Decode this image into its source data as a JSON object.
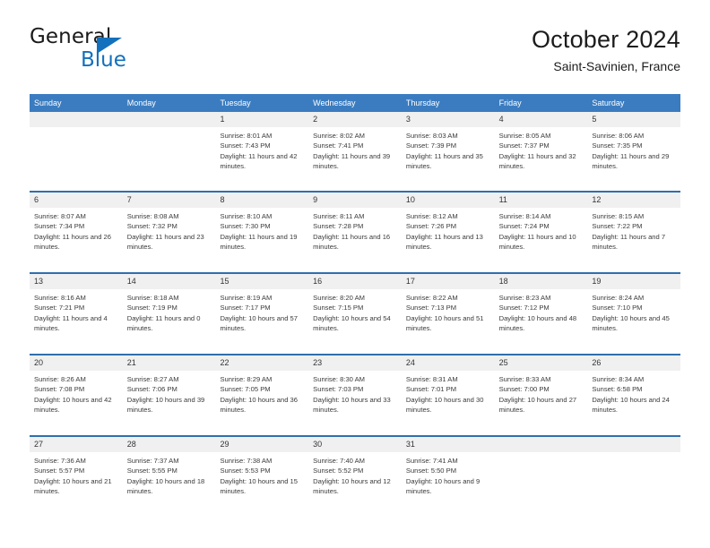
{
  "brand": {
    "name_top": "General",
    "name_bottom": "Blue",
    "accent_color": "#1270bd"
  },
  "header": {
    "title": "October 2024",
    "subtitle": "Saint-Savinien, France"
  },
  "theme": {
    "header_blue": "#3b7cc0",
    "row_rule_blue": "#2f6fad",
    "day_band_gray": "#f0f0f0"
  },
  "weekdays": [
    "Sunday",
    "Monday",
    "Tuesday",
    "Wednesday",
    "Thursday",
    "Friday",
    "Saturday"
  ],
  "labels": {
    "sunrise_prefix": "Sunrise:",
    "sunset_prefix": "Sunset:",
    "daylight_prefix": "Daylight:"
  },
  "weeks": [
    [
      {
        "day": "",
        "empty": true
      },
      {
        "day": "",
        "empty": true
      },
      {
        "day": "1",
        "sunrise": "Sunrise: 8:01 AM",
        "sunset": "Sunset: 7:43 PM",
        "daylight": "Daylight: 11 hours and 42 minutes."
      },
      {
        "day": "2",
        "sunrise": "Sunrise: 8:02 AM",
        "sunset": "Sunset: 7:41 PM",
        "daylight": "Daylight: 11 hours and 39 minutes."
      },
      {
        "day": "3",
        "sunrise": "Sunrise: 8:03 AM",
        "sunset": "Sunset: 7:39 PM",
        "daylight": "Daylight: 11 hours and 35 minutes."
      },
      {
        "day": "4",
        "sunrise": "Sunrise: 8:05 AM",
        "sunset": "Sunset: 7:37 PM",
        "daylight": "Daylight: 11 hours and 32 minutes."
      },
      {
        "day": "5",
        "sunrise": "Sunrise: 8:06 AM",
        "sunset": "Sunset: 7:35 PM",
        "daylight": "Daylight: 11 hours and 29 minutes."
      }
    ],
    [
      {
        "day": "6",
        "sunrise": "Sunrise: 8:07 AM",
        "sunset": "Sunset: 7:34 PM",
        "daylight": "Daylight: 11 hours and 26 minutes."
      },
      {
        "day": "7",
        "sunrise": "Sunrise: 8:08 AM",
        "sunset": "Sunset: 7:32 PM",
        "daylight": "Daylight: 11 hours and 23 minutes."
      },
      {
        "day": "8",
        "sunrise": "Sunrise: 8:10 AM",
        "sunset": "Sunset: 7:30 PM",
        "daylight": "Daylight: 11 hours and 19 minutes."
      },
      {
        "day": "9",
        "sunrise": "Sunrise: 8:11 AM",
        "sunset": "Sunset: 7:28 PM",
        "daylight": "Daylight: 11 hours and 16 minutes."
      },
      {
        "day": "10",
        "sunrise": "Sunrise: 8:12 AM",
        "sunset": "Sunset: 7:26 PM",
        "daylight": "Daylight: 11 hours and 13 minutes."
      },
      {
        "day": "11",
        "sunrise": "Sunrise: 8:14 AM",
        "sunset": "Sunset: 7:24 PM",
        "daylight": "Daylight: 11 hours and 10 minutes."
      },
      {
        "day": "12",
        "sunrise": "Sunrise: 8:15 AM",
        "sunset": "Sunset: 7:22 PM",
        "daylight": "Daylight: 11 hours and 7 minutes."
      }
    ],
    [
      {
        "day": "13",
        "sunrise": "Sunrise: 8:16 AM",
        "sunset": "Sunset: 7:21 PM",
        "daylight": "Daylight: 11 hours and 4 minutes."
      },
      {
        "day": "14",
        "sunrise": "Sunrise: 8:18 AM",
        "sunset": "Sunset: 7:19 PM",
        "daylight": "Daylight: 11 hours and 0 minutes."
      },
      {
        "day": "15",
        "sunrise": "Sunrise: 8:19 AM",
        "sunset": "Sunset: 7:17 PM",
        "daylight": "Daylight: 10 hours and 57 minutes."
      },
      {
        "day": "16",
        "sunrise": "Sunrise: 8:20 AM",
        "sunset": "Sunset: 7:15 PM",
        "daylight": "Daylight: 10 hours and 54 minutes."
      },
      {
        "day": "17",
        "sunrise": "Sunrise: 8:22 AM",
        "sunset": "Sunset: 7:13 PM",
        "daylight": "Daylight: 10 hours and 51 minutes."
      },
      {
        "day": "18",
        "sunrise": "Sunrise: 8:23 AM",
        "sunset": "Sunset: 7:12 PM",
        "daylight": "Daylight: 10 hours and 48 minutes."
      },
      {
        "day": "19",
        "sunrise": "Sunrise: 8:24 AM",
        "sunset": "Sunset: 7:10 PM",
        "daylight": "Daylight: 10 hours and 45 minutes."
      }
    ],
    [
      {
        "day": "20",
        "sunrise": "Sunrise: 8:26 AM",
        "sunset": "Sunset: 7:08 PM",
        "daylight": "Daylight: 10 hours and 42 minutes."
      },
      {
        "day": "21",
        "sunrise": "Sunrise: 8:27 AM",
        "sunset": "Sunset: 7:06 PM",
        "daylight": "Daylight: 10 hours and 39 minutes."
      },
      {
        "day": "22",
        "sunrise": "Sunrise: 8:29 AM",
        "sunset": "Sunset: 7:05 PM",
        "daylight": "Daylight: 10 hours and 36 minutes."
      },
      {
        "day": "23",
        "sunrise": "Sunrise: 8:30 AM",
        "sunset": "Sunset: 7:03 PM",
        "daylight": "Daylight: 10 hours and 33 minutes."
      },
      {
        "day": "24",
        "sunrise": "Sunrise: 8:31 AM",
        "sunset": "Sunset: 7:01 PM",
        "daylight": "Daylight: 10 hours and 30 minutes."
      },
      {
        "day": "25",
        "sunrise": "Sunrise: 8:33 AM",
        "sunset": "Sunset: 7:00 PM",
        "daylight": "Daylight: 10 hours and 27 minutes."
      },
      {
        "day": "26",
        "sunrise": "Sunrise: 8:34 AM",
        "sunset": "Sunset: 6:58 PM",
        "daylight": "Daylight: 10 hours and 24 minutes."
      }
    ],
    [
      {
        "day": "27",
        "sunrise": "Sunrise: 7:36 AM",
        "sunset": "Sunset: 5:57 PM",
        "daylight": "Daylight: 10 hours and 21 minutes."
      },
      {
        "day": "28",
        "sunrise": "Sunrise: 7:37 AM",
        "sunset": "Sunset: 5:55 PM",
        "daylight": "Daylight: 10 hours and 18 minutes."
      },
      {
        "day": "29",
        "sunrise": "Sunrise: 7:38 AM",
        "sunset": "Sunset: 5:53 PM",
        "daylight": "Daylight: 10 hours and 15 minutes."
      },
      {
        "day": "30",
        "sunrise": "Sunrise: 7:40 AM",
        "sunset": "Sunset: 5:52 PM",
        "daylight": "Daylight: 10 hours and 12 minutes."
      },
      {
        "day": "31",
        "sunrise": "Sunrise: 7:41 AM",
        "sunset": "Sunset: 5:50 PM",
        "daylight": "Daylight: 10 hours and 9 minutes."
      },
      {
        "day": "",
        "empty": true
      },
      {
        "day": "",
        "empty": true
      }
    ]
  ]
}
